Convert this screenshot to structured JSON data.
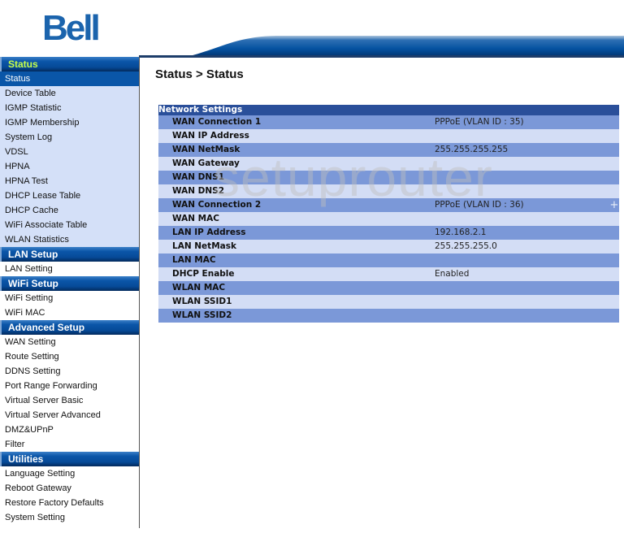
{
  "brand": {
    "logo_text": "Bell",
    "logo_color": "#1b64ad"
  },
  "page": {
    "title": "Status > Status"
  },
  "watermark": "setuprouter",
  "sidebar": {
    "sections": [
      {
        "title": "Status",
        "items": [
          {
            "label": "Status",
            "active": true
          },
          {
            "label": "Device Table"
          },
          {
            "label": "IGMP Statistic"
          },
          {
            "label": "IGMP Membership"
          },
          {
            "label": "System Log"
          },
          {
            "label": "VDSL"
          },
          {
            "label": "HPNA"
          },
          {
            "label": "HPNA Test"
          },
          {
            "label": "DHCP Lease Table"
          },
          {
            "label": "DHCP Cache"
          },
          {
            "label": "WiFi Associate Table"
          },
          {
            "label": "WLAN Statistics"
          }
        ]
      },
      {
        "title": "LAN Setup",
        "items": [
          {
            "label": "LAN Setting"
          }
        ]
      },
      {
        "title": "WiFi Setup",
        "items": [
          {
            "label": "WiFi Setting"
          },
          {
            "label": "WiFi MAC"
          }
        ]
      },
      {
        "title": "Advanced Setup",
        "items": [
          {
            "label": "WAN Setting"
          },
          {
            "label": "Route Setting"
          },
          {
            "label": "DDNS Setting"
          },
          {
            "label": "Port Range Forwarding"
          },
          {
            "label": "Virtual Server Basic"
          },
          {
            "label": "Virtual Server Advanced"
          },
          {
            "label": "DMZ&UPnP"
          },
          {
            "label": "Filter"
          }
        ]
      },
      {
        "title": "Utilities",
        "items": [
          {
            "label": "Language Setting"
          },
          {
            "label": "Reboot Gateway"
          },
          {
            "label": "Restore Factory Defaults"
          },
          {
            "label": "System Setting"
          }
        ]
      }
    ]
  },
  "network_settings": {
    "title": "Network Settings",
    "rows": [
      {
        "label": "WAN Connection 1",
        "value": "PPPoE (VLAN ID : 35)"
      },
      {
        "label": "WAN IP Address",
        "value": ""
      },
      {
        "label": "WAN NetMask",
        "value": "255.255.255.255"
      },
      {
        "label": "WAN Gateway",
        "value": ""
      },
      {
        "label": "WAN DNS1",
        "value": ""
      },
      {
        "label": "WAN DNS2",
        "value": ""
      },
      {
        "label": "WAN Connection  2",
        "value": "PPPoE (VLAN ID : 36)",
        "expand": "+"
      },
      {
        "label": "WAN MAC",
        "value": ""
      },
      {
        "label": "LAN IP Address",
        "value": "192.168.2.1"
      },
      {
        "label": "LAN NetMask",
        "value": "255.255.255.0"
      },
      {
        "label": "LAN MAC",
        "value": ""
      },
      {
        "label": "DHCP Enable",
        "value": "Enabled"
      },
      {
        "label": "WLAN MAC",
        "value": ""
      },
      {
        "label": "WLAN SSID1",
        "value": ""
      },
      {
        "label": "WLAN SSID2",
        "value": ""
      }
    ]
  }
}
